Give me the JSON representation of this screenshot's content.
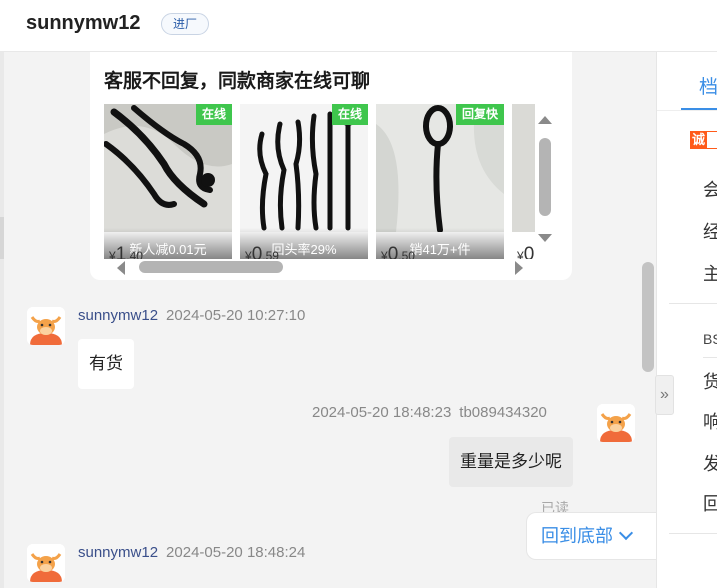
{
  "header": {
    "name": "sunnymw12",
    "tag": "进厂"
  },
  "card": {
    "title": "客服不回复，同款商家在线可聊",
    "products": [
      {
        "badge": "在线",
        "caption": "新人减0.01元",
        "price_symbol": "¥",
        "price_int": "1",
        "price_dec": ".40"
      },
      {
        "badge": "在线",
        "caption": "回头率29%",
        "price_symbol": "¥",
        "price_int": "0",
        "price_dec": ".59"
      },
      {
        "badge": "回复快",
        "caption": "销41万+件",
        "price_symbol": "¥",
        "price_int": "0",
        "price_dec": ".50"
      },
      {
        "badge": "",
        "caption": "",
        "price_symbol": "¥",
        "price_int": "0",
        "price_dec": ""
      }
    ]
  },
  "messages": [
    {
      "nick": "sunnymw12",
      "time": "2024-05-20 10:27:10",
      "text": "有货"
    },
    {
      "time": "2024-05-20 18:48:23",
      "user": "tb089434320",
      "text": "重量是多少呢",
      "status": "已读"
    },
    {
      "nick": "sunnymw12",
      "time": "2024-05-20 18:48:24"
    }
  ],
  "actions": {
    "to_bottom": "回到底部",
    "collapse": "»"
  },
  "right_panel": {
    "tab": "档",
    "logo": "诚",
    "rows_top": [
      "会",
      "经",
      "主"
    ],
    "bs": "BS",
    "rows_bottom": [
      "货",
      "响",
      "发",
      "回"
    ]
  },
  "colors": {
    "accent": "#3a8ee6",
    "badge": "#3fc64d",
    "nick": "#3a4f8a"
  },
  "icons": {
    "avatar": "cow-avatar-icon",
    "collapse": "double-chevron-right-icon",
    "to_bottom": "chevron-down-icon"
  }
}
